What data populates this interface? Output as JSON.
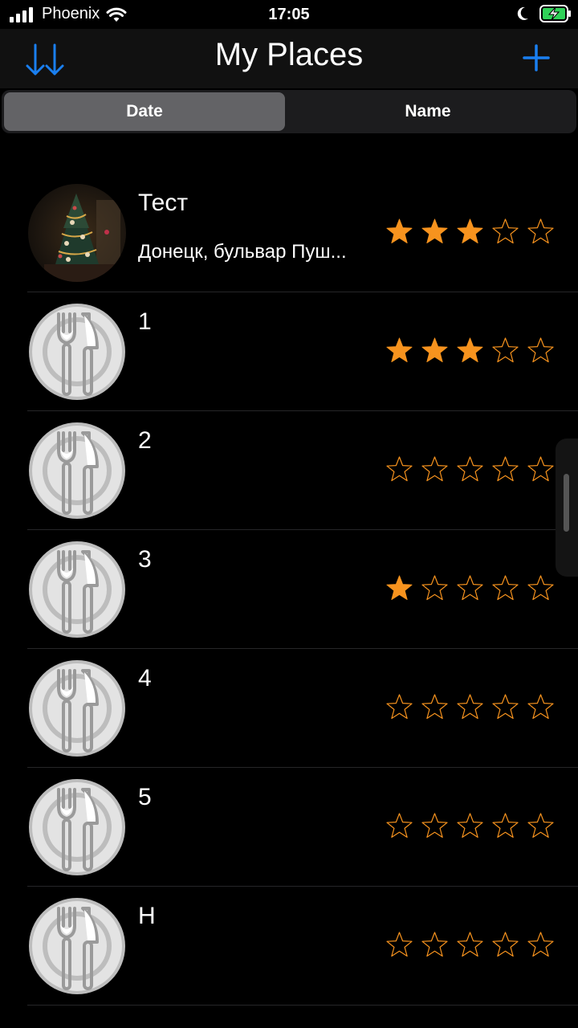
{
  "status_bar": {
    "carrier": "Phoenix",
    "time": "17:05",
    "icons": [
      "cellular-signal-icon",
      "wifi-icon",
      "moon-icon",
      "battery-charging-icon"
    ]
  },
  "nav": {
    "title": "My Places",
    "sort_icon": "sort-arrows-icon",
    "add_icon": "plus-icon",
    "accent_color": "#1a7ff0"
  },
  "segments": [
    {
      "label": "Date",
      "selected": true
    },
    {
      "label": "Name",
      "selected": false
    }
  ],
  "places": [
    {
      "name": "Тест",
      "location": "Донецк, бульвар Пуш...",
      "rating": 3,
      "image": "christmas-tree-photo"
    },
    {
      "name": "1",
      "location": "",
      "rating": 3,
      "image": "plate-fork-knife-icon"
    },
    {
      "name": "2",
      "location": "",
      "rating": 0,
      "image": "plate-fork-knife-icon"
    },
    {
      "name": "3",
      "location": "",
      "rating": 1,
      "image": "plate-fork-knife-icon"
    },
    {
      "name": "4",
      "location": "",
      "rating": 0,
      "image": "plate-fork-knife-icon"
    },
    {
      "name": "5",
      "location": "",
      "rating": 0,
      "image": "plate-fork-knife-icon"
    },
    {
      "name": "Н",
      "location": "",
      "rating": 0,
      "image": "plate-fork-knife-icon"
    }
  ],
  "star_max": 5,
  "star_color": "#f7931e"
}
